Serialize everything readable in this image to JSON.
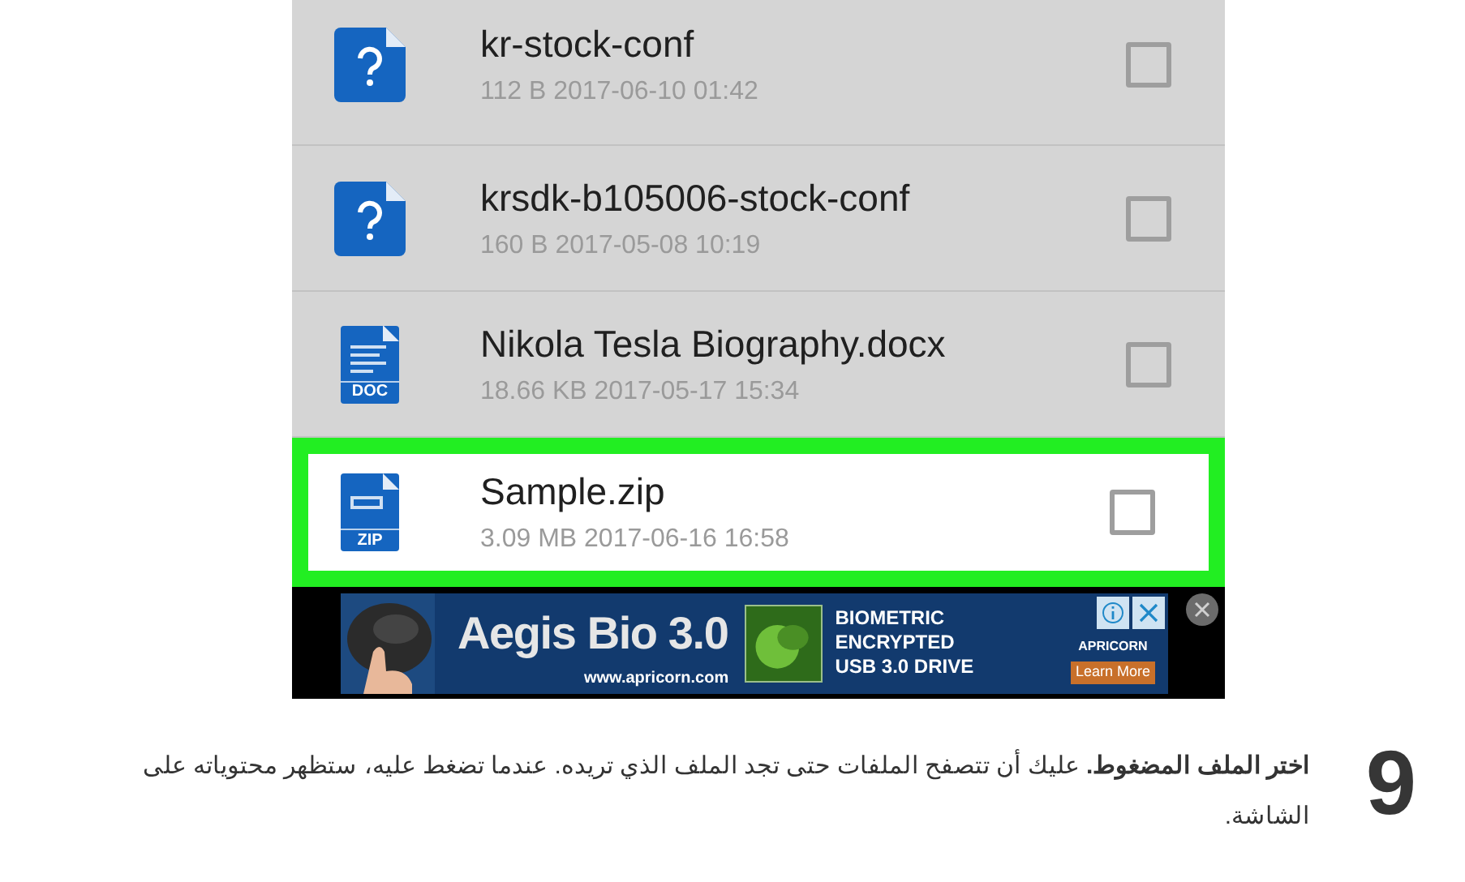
{
  "files": [
    {
      "name": "kr-stock-conf",
      "meta": "112 B 2017-06-10 01:42",
      "kind": "unknown",
      "highlighted": false,
      "checked": false
    },
    {
      "name": "krsdk-b105006-stock-conf",
      "meta": "160 B 2017-05-08 10:19",
      "kind": "unknown",
      "highlighted": false,
      "checked": false
    },
    {
      "name": "Nikola Tesla Biography.docx",
      "meta": "18.66 KB 2017-05-17 15:34",
      "kind": "doc",
      "icon_label": "DOC",
      "highlighted": false,
      "checked": false
    },
    {
      "name": "Sample.zip",
      "meta": "3.09 MB 2017-06-16 16:58",
      "kind": "zip",
      "icon_label": "ZIP",
      "highlighted": true,
      "checked": false
    }
  ],
  "ad": {
    "headline": "Aegis Bio 3.0",
    "url": "www.apricorn.com",
    "tagline": [
      "BIOMETRIC",
      "ENCRYPTED",
      "USB 3.0 DRIVE"
    ],
    "brand": "APRICORN",
    "cta": "Learn More"
  },
  "step": {
    "number": "9",
    "text": "**اختر الملف المضغوط.** عليك أن تتصفح الملفات حتى تجد الملف الذي تريده. عندما تضغط عليه، ستظهر محتوياته على الشاشة."
  }
}
